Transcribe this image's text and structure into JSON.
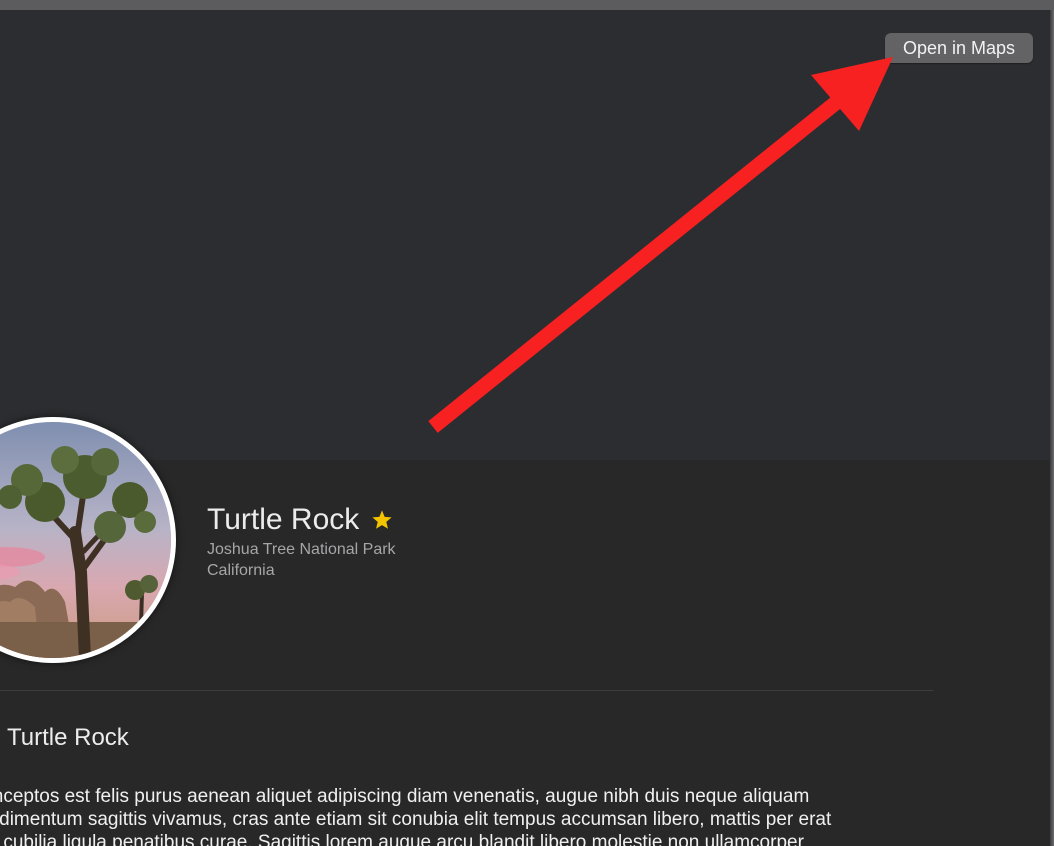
{
  "header": {
    "open_in_maps_label": "Open in Maps"
  },
  "landmark": {
    "name": "Turtle Rock",
    "is_favorite": true,
    "park": "Joshua Tree National Park",
    "state": "California",
    "image_description": "joshua-tree-photo"
  },
  "about": {
    "heading": "Turtle Rock",
    "description": "t inceptos est felis purus aenean aliquet adipiscing diam venenatis, augue nibh duis neque aliquam\nondimentum sagittis vivamus, cras ante etiam sit conubia elit tempus accumsan libero, mattis per erat\nse cubilia ligula penatibus curae. Sagittis lorem augue arcu blandit libero molestie non ullamcorper"
  },
  "colors": {
    "annotation_arrow": "#f72121",
    "favorite_star": "#f5c400",
    "button_bg": "#636366",
    "map_bg": "#2c2d30",
    "content_bg": "#282828"
  },
  "icons": {
    "favorite": "star-filled-icon",
    "annotation": "red-arrow-annotation"
  }
}
